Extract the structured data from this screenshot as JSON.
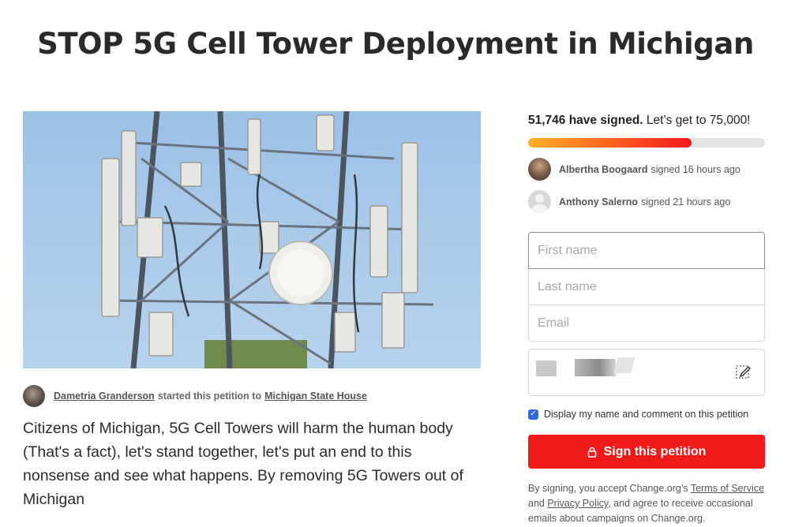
{
  "title": "STOP 5G Cell Tower Deployment in Michigan",
  "hero_image": {
    "description_icon": "cell-tower-photo"
  },
  "starter": {
    "name": "Dametria Granderson",
    "middle_text": "started this petition to",
    "target": "Michigan State House"
  },
  "description": "Citizens of Michigan, 5G Cell Towers will harm the human body (That's a fact), let's stand together, let's put an end to this nonsense and see what happens. By removing 5G Towers out of Michigan",
  "signatures": {
    "count_text": "51,746 have signed.",
    "goal_text": "Let’s get to 75,000!",
    "progress": 0.69,
    "colors": {
      "start": "#ffb12b",
      "end": "#f2181f",
      "track": "#e3e3e3"
    }
  },
  "recent_signers": [
    {
      "name": "Albertha Boogaard",
      "action": "signed 16 hours ago"
    },
    {
      "name": "Anthony Salerno",
      "action": "signed 21 hours ago"
    }
  ],
  "form": {
    "first_name_placeholder": "First name",
    "last_name_placeholder": "Last name",
    "email_placeholder": "Email"
  },
  "display_checkbox": {
    "checked": true,
    "label": "Display my name and comment on this petition"
  },
  "sign_button": {
    "label": "Sign this petition",
    "color": "#ef1b1b"
  },
  "legal": {
    "prefix": "By signing, you accept Change.org’s",
    "terms_link": "Terms of Service",
    "and": "and",
    "privacy_link": "Privacy Policy",
    "suffix": ", and agree to receive occasional emails about campaigns on Change.org."
  }
}
